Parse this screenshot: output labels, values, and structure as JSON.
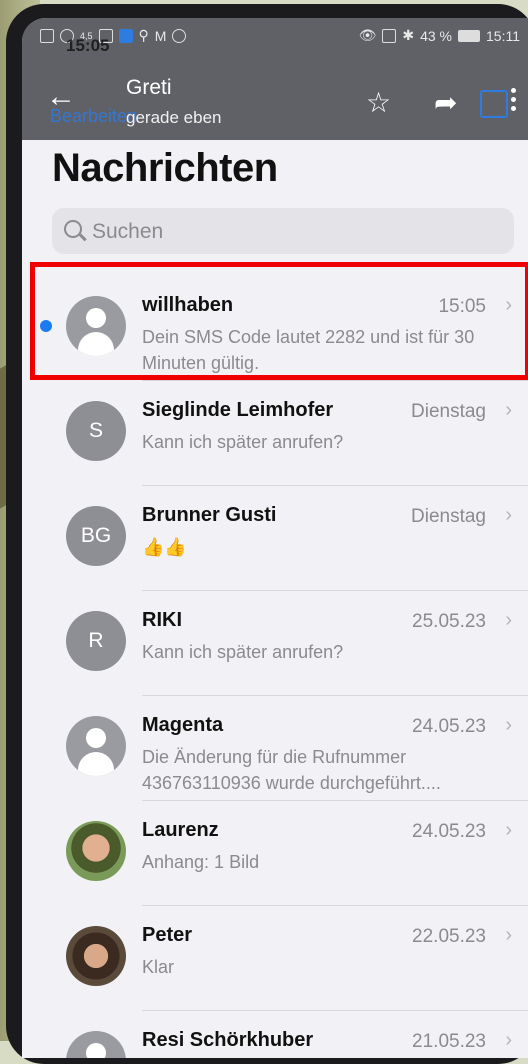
{
  "status": {
    "time_overlay": "15:05",
    "time": "15:11",
    "battery_percent": "43 %",
    "network_small": "4,5"
  },
  "header": {
    "contact_name": "Greti",
    "contact_status": "gerade eben",
    "edit_label_behind": "Bearbeiten"
  },
  "page": {
    "title": "Nachrichten"
  },
  "search": {
    "placeholder": "Suchen"
  },
  "conversations": [
    {
      "name": "willhaben",
      "date": "15:05",
      "message": "Dein SMS Code lautet 2282 und ist für 30 Minuten gültig.",
      "avatar": "person",
      "unread": true
    },
    {
      "name": "Sieglinde Leimhofer",
      "date": "Dienstag",
      "message": "Kann ich später anrufen?",
      "avatar": "S"
    },
    {
      "name": "Brunner Gusti",
      "date": "Dienstag",
      "message": "👍👍",
      "avatar": "BG"
    },
    {
      "name": "RIKI",
      "date": "25.05.23",
      "message": "Kann ich später anrufen?",
      "avatar": "R"
    },
    {
      "name": "Magenta",
      "date": "24.05.23",
      "message": "Die Änderung für die Rufnummer 436763110936 wurde durchgeführt....",
      "avatar": "person"
    },
    {
      "name": "Laurenz",
      "date": "24.05.23",
      "message": "Anhang: 1 Bild",
      "avatar": "photo"
    },
    {
      "name": "Peter",
      "date": "22.05.23",
      "message": "Klar",
      "avatar": "photo"
    },
    {
      "name": "Resi Schörkhuber",
      "date": "21.05.23",
      "message": "",
      "avatar": "person"
    }
  ],
  "colors": {
    "accent": "#1b7cf0",
    "highlight": "#f00000",
    "topbar": "#5f6167"
  }
}
